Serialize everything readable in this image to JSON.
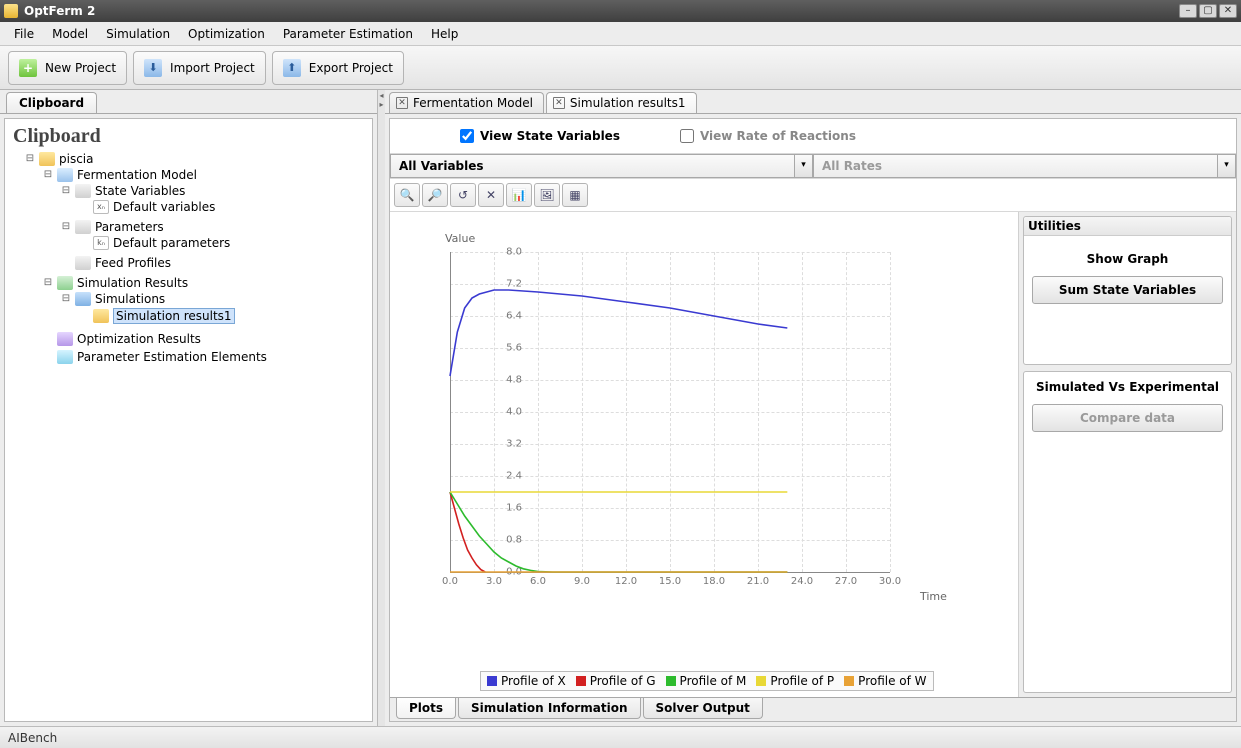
{
  "window": {
    "title": "OptFerm 2"
  },
  "menu": {
    "items": [
      "File",
      "Model",
      "Simulation",
      "Optimization",
      "Parameter Estimation",
      "Help"
    ]
  },
  "toolbar": {
    "new_label": "New Project",
    "import_label": "Import Project",
    "export_label": "Export Project"
  },
  "clipboard": {
    "tab_label": "Clipboard",
    "header": "Clipboard",
    "tree": {
      "root": "piscia",
      "model": "Fermentation Model",
      "state_vars": "State Variables",
      "default_vars": "Default variables",
      "parameters": "Parameters",
      "default_params": "Default parameters",
      "feed_profiles": "Feed Profiles",
      "sim_results": "Simulation Results",
      "simulations": "Simulations",
      "sim_results1": "Simulation results1",
      "opt_results": "Optimization Results",
      "param_est": "Parameter Estimation Elements"
    }
  },
  "right_tabs": {
    "tab1": "Fermentation Model",
    "tab2": "Simulation results1"
  },
  "view": {
    "state_vars": "View State Variables",
    "rate_reactions": "View Rate of Reactions"
  },
  "selectors": {
    "all_vars": "All Variables",
    "all_rates": "All Rates"
  },
  "utilities": {
    "header": "Utilities",
    "show_graph": "Show Graph",
    "sum_state": "Sum State Variables",
    "sim_vs_exp": "Simulated Vs Experimental",
    "compare": "Compare data"
  },
  "bottom_tabs": {
    "plots": "Plots",
    "sim_info": "Simulation Information",
    "solver": "Solver Output"
  },
  "status": {
    "text": "AIBench"
  },
  "chart_data": {
    "type": "line",
    "title": "Value",
    "xlabel": "Time",
    "ylabel": "",
    "xlim": [
      0,
      30
    ],
    "ylim": [
      0,
      8
    ],
    "xticks": [
      0.0,
      3.0,
      6.0,
      9.0,
      12.0,
      15.0,
      18.0,
      21.0,
      24.0,
      27.0,
      30.0
    ],
    "yticks": [
      0.0,
      0.8,
      1.6,
      2.4,
      3.2,
      4.0,
      4.8,
      5.6,
      6.4,
      7.2,
      8.0
    ],
    "series": [
      {
        "name": "Profile of X",
        "color": "#3a3ad1",
        "x": [
          0,
          0.5,
          1,
          1.5,
          2,
          3,
          4,
          6,
          9,
          12,
          15,
          18,
          21,
          23
        ],
        "y": [
          4.9,
          6.0,
          6.6,
          6.85,
          6.95,
          7.05,
          7.05,
          7.0,
          6.9,
          6.75,
          6.6,
          6.4,
          6.2,
          6.1
        ]
      },
      {
        "name": "Profile of G",
        "color": "#d22020",
        "x": [
          0,
          0.3,
          0.6,
          0.9,
          1.2,
          1.5,
          1.8,
          2.1,
          2.4
        ],
        "y": [
          2.0,
          1.6,
          1.2,
          0.85,
          0.55,
          0.35,
          0.18,
          0.06,
          0.0
        ]
      },
      {
        "name": "Profile of M",
        "color": "#2dbb2d",
        "x": [
          0,
          0.5,
          1,
          1.5,
          2,
          2.5,
          3,
          3.5,
          4,
          4.5,
          5,
          5.5,
          6,
          7,
          8,
          10,
          15,
          23
        ],
        "y": [
          2.0,
          1.7,
          1.4,
          1.15,
          0.9,
          0.7,
          0.5,
          0.35,
          0.25,
          0.15,
          0.08,
          0.04,
          0.01,
          0,
          0,
          0,
          0,
          0
        ]
      },
      {
        "name": "Profile of P",
        "color": "#e8d836",
        "x": [
          0,
          23
        ],
        "y": [
          2.0,
          2.0
        ]
      },
      {
        "name": "Profile of W",
        "color": "#e8a236",
        "x": [
          0,
          23
        ],
        "y": [
          0.0,
          0.0
        ]
      }
    ]
  }
}
